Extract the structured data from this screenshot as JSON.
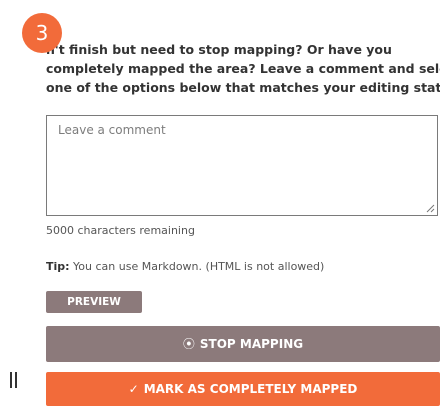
{
  "step": {
    "number": "3"
  },
  "instructions": {
    "line1": "n't finish but need to stop mapping? Or have you",
    "line2": "completely mapped the area? Leave a comment and select",
    "line3": "one of the options below that matches your editing status."
  },
  "comment": {
    "placeholder": "Leave a comment",
    "value": ""
  },
  "char_count": "5000 characters remaining",
  "tip": {
    "label": "Tip:",
    "text": " You can use Markdown. (HTML is not allowed)"
  },
  "buttons": {
    "preview_label": "PREVIEW",
    "stop_icon": "⦿",
    "stop_label": "STOP MAPPING",
    "mark_icon": "✓",
    "mark_label": "MARK AS COMPLETELY MAPPED"
  },
  "colors": {
    "accent": "#f26b3a",
    "secondary": "#8c7a7b"
  }
}
